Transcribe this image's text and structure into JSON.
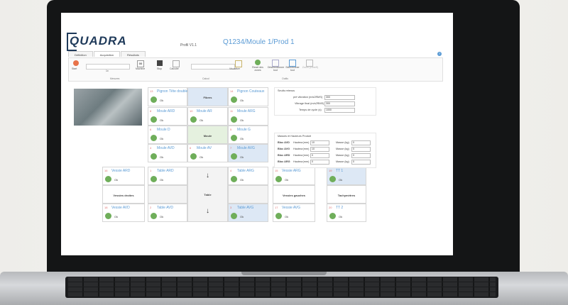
{
  "app": {
    "logo": "QUADRA",
    "profil": "Profil V1.1",
    "title": "Q1234/Moule 1/Prod 1",
    "tabs": [
      "Définition",
      "Acquisition",
      "Résultats"
    ],
    "help": "?"
  },
  "ribbon": {
    "start": "Start",
    "x1": "1x",
    "mesures": "Mesures",
    "stop": "Stop",
    "calculer": "Calculer",
    "visualiser": "Visualiser",
    "calcul_label": "Calcul",
    "reset": "Reset des zones",
    "deselect": "Désélectionner tout",
    "select": "Sélectionner tout",
    "zoom": "Zoom (ZoneS)",
    "outils_label": "Outils",
    "mesures_group": "Mesures",
    "machine_label": "Machine",
    "machine_value": "00"
  },
  "grid": {
    "pignon_double": {
      "num": "13",
      "title": "Pignon Tête double",
      "ok": "Ok"
    },
    "fibres": "Fibres",
    "pignon_couteau": {
      "num": "14",
      "title": "Pignon Couteaux",
      "ok": "Ok"
    },
    "moule_ard": {
      "num": "8",
      "title": "Moule ARD",
      "ok": "Ok"
    },
    "moule_ar": {
      "num": "10",
      "title": "Moule AR",
      "ok": "Ok"
    },
    "moule_arg": {
      "num": "11",
      "title": "Moule ARG",
      "ok": "Ok"
    },
    "moule_d": {
      "num": "6",
      "title": "Moule D",
      "ok": "Ok"
    },
    "moule": "Moule",
    "moule_g": {
      "num": "5",
      "title": "Moule G",
      "ok": "Ok"
    },
    "moule_avd": {
      "num": "4",
      "title": "Moule AVD",
      "ok": "Ok"
    },
    "moule_av": {
      "num": "6",
      "title": "Moule AV",
      "ok": "Ok"
    },
    "moule_avg": {
      "num": "7",
      "title": "Moule AVG",
      "ok": "Ok"
    },
    "vessie_ard": {
      "num": "16",
      "title": "Vessie ARD",
      "ok": "Ok"
    },
    "vessie_droite": "Vessies droites",
    "vessie_avd": {
      "num": "18",
      "title": "Vessie AVD",
      "ok": "Ok"
    },
    "table_ard": {
      "num": "1",
      "title": "Table ARD",
      "ok": "Ok"
    },
    "table": "Table",
    "table_arg": {
      "num": "4",
      "title": "Table ARG",
      "ok": "Ok"
    },
    "table_avd": {
      "num": "2",
      "title": "Table AVD",
      "ok": "Ok"
    },
    "table_avg": {
      "num": "3",
      "title": "Table AVG",
      "ok": "Ok"
    },
    "vessie_arg": {
      "num": "15",
      "title": "Vessie ARG",
      "ok": "Ok"
    },
    "vessie_gauche": "Vessies gauches",
    "vessie_avg": {
      "num": "17",
      "title": "Vessie AVG",
      "ok": "Ok"
    },
    "tt1": {
      "num": "19",
      "title": "TT 1",
      "ok": "Ok"
    },
    "tachymetres": "Tachymètres",
    "tt2": {
      "num": "20",
      "title": "TT 2",
      "ok": "Ok"
    },
    "down_arrow": "↓"
  },
  "seuils": {
    "title": "Seuils retenus",
    "rows": [
      {
        "label": "pré vibration (m/s2RMS)",
        "value": "300"
      },
      {
        "label": "Vibrage final (m/s2RMS)",
        "value": "300"
      },
      {
        "label": "Temps de cycle (s)",
        "value": "1000"
      }
    ]
  },
  "masses": {
    "title": "Masses et Hauteurs Produit",
    "rows": [
      {
        "name": "Bloc AVD",
        "h_label": "Hauteur(mm)",
        "h": "10",
        "m_label": "Masse (kg)",
        "m": "0"
      },
      {
        "name": "Bloc AVG",
        "h_label": "Hauteur(mm)",
        "h": "10",
        "m_label": "Masse (kg)",
        "m": "0"
      },
      {
        "name": "Bloc ARD",
        "h_label": "Hauteur(mm)",
        "h": "0",
        "m_label": "Masse (kg)",
        "m": "0"
      },
      {
        "name": "Bloc ARG",
        "h_label": "Hauteur(mm)",
        "h": "0",
        "m_label": "Masse (kg)",
        "m": "0"
      }
    ]
  }
}
